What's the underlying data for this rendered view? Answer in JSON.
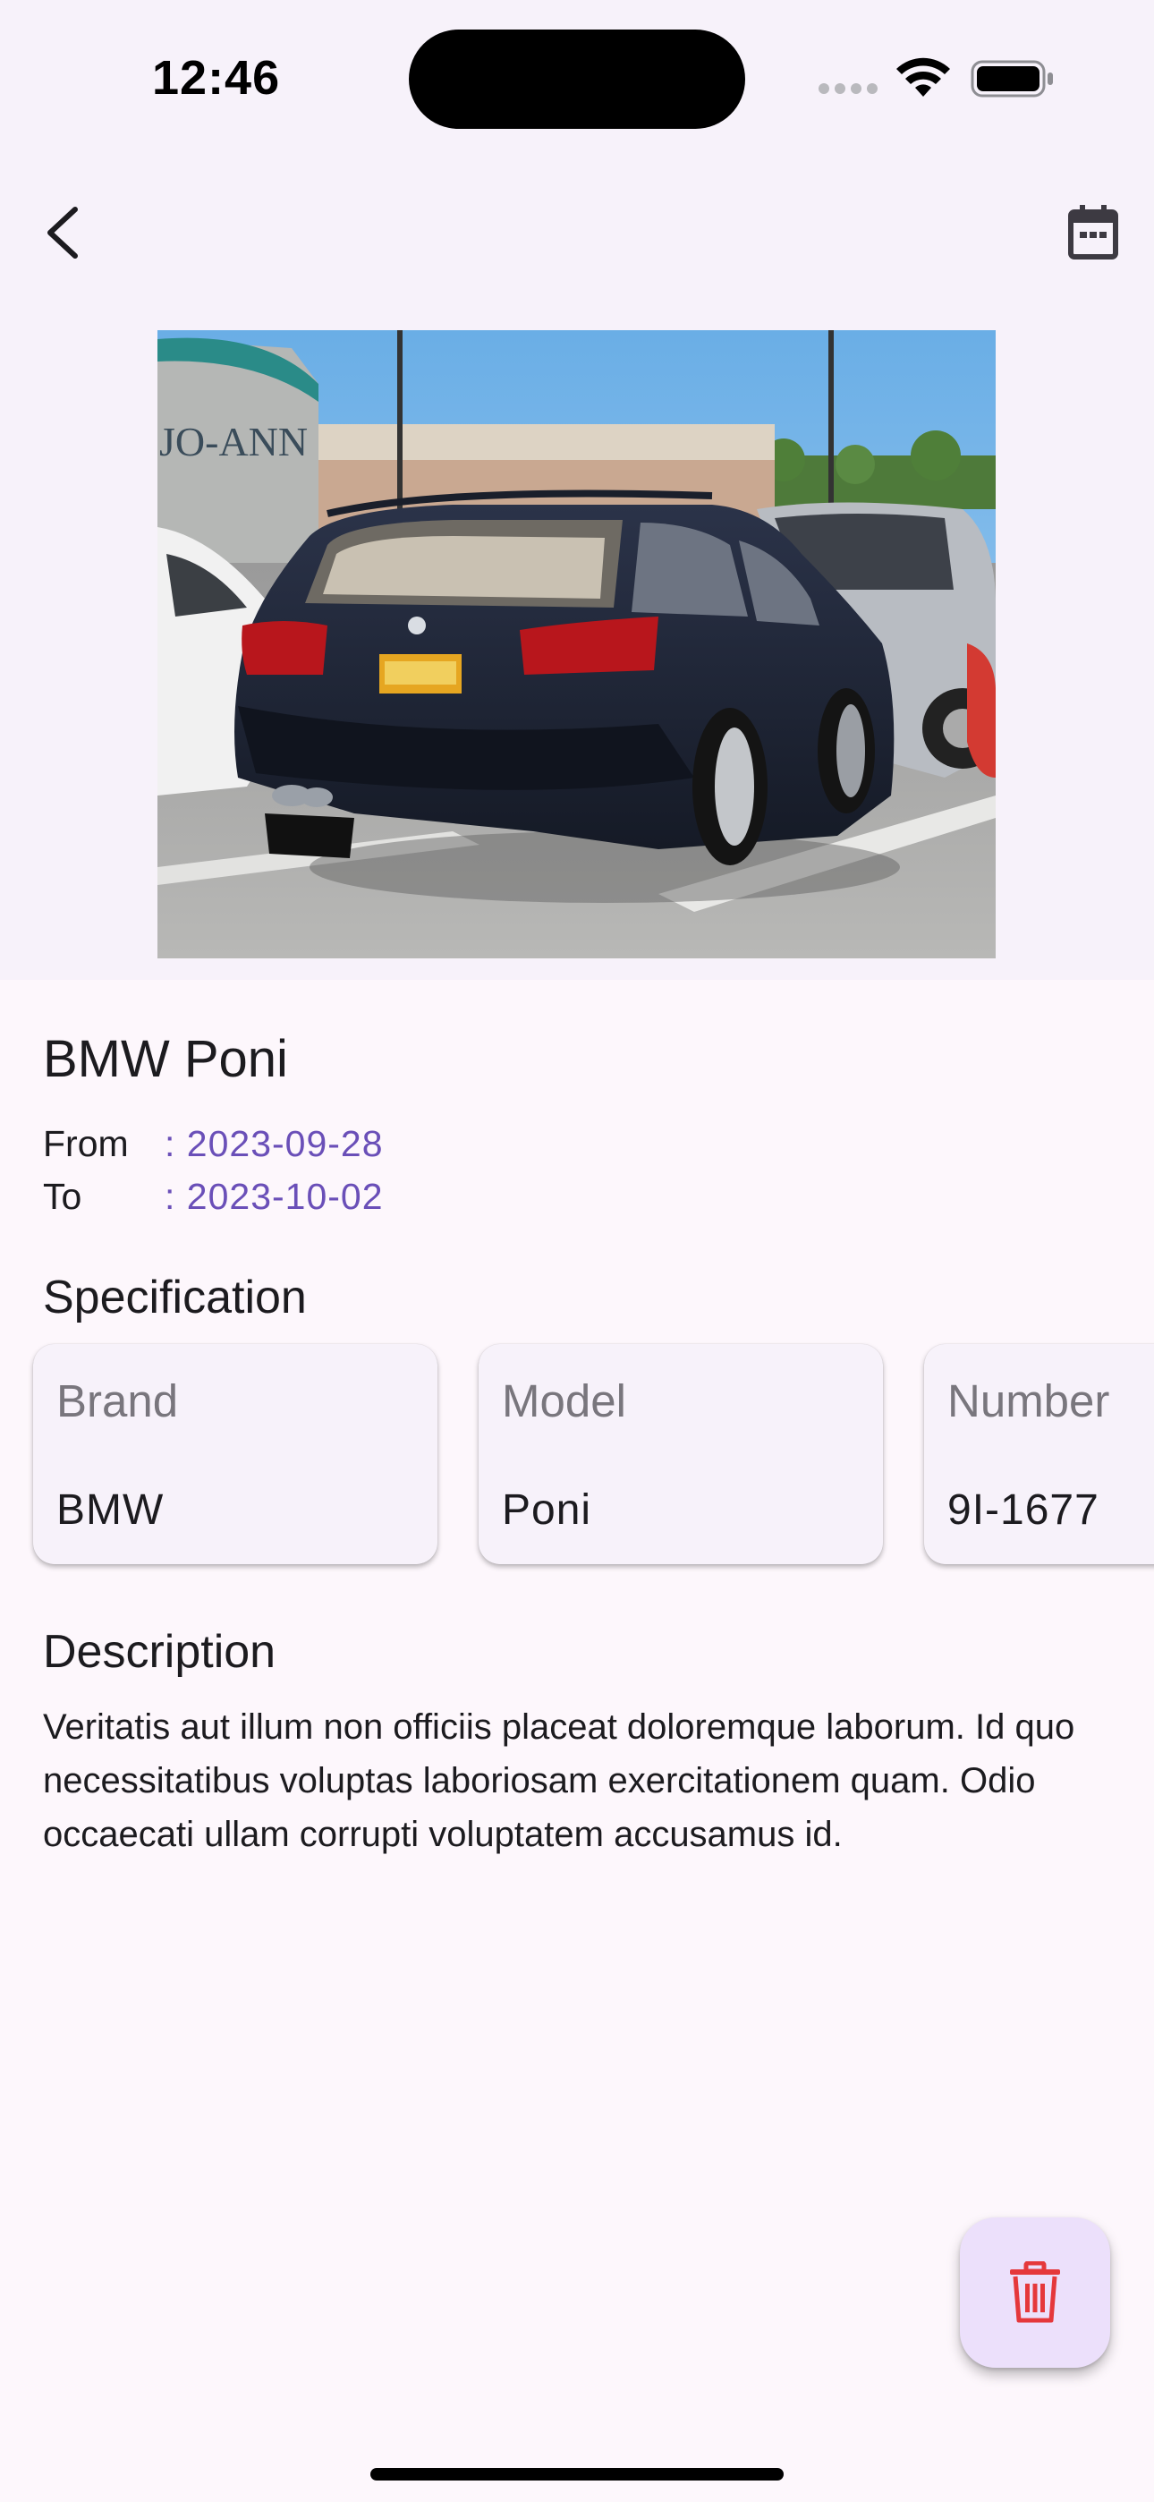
{
  "status_bar": {
    "time": "12:46",
    "icons": [
      "cellular-signal-icon",
      "wifi-icon",
      "battery-icon"
    ]
  },
  "app_bar": {
    "back_icon": "chevron-left-icon",
    "action_icon": "calendar-icon"
  },
  "hero_image": {
    "description_text_on_store": "JO-ANN"
  },
  "car": {
    "title": "BMW Poni",
    "from_label": "From",
    "from_value": ": 2023-09-28",
    "to_label": "To",
    "to_value": ": 2023-10-02"
  },
  "specification": {
    "title": "Specification",
    "cards": [
      {
        "label": "Brand",
        "value": "BMW"
      },
      {
        "label": "Model",
        "value": "Poni"
      },
      {
        "label": "Number",
        "value": "9I-1677"
      }
    ]
  },
  "description": {
    "title": "Description",
    "text": "Veritatis aut illum non officiis placeat doloremque laborum. Id quo necessitatibus voluptas laboriosam exercitationem quam. Odio occaecati ullam corrupti voluptatem accusamus id."
  },
  "fab": {
    "icon": "trash-icon"
  },
  "colors": {
    "background": "#fdf7fc",
    "surface": "#f7f2fa",
    "accent_date": "#6a4fb8",
    "fab_background": "#ece0fb",
    "fab_icon": "#e5383b"
  }
}
